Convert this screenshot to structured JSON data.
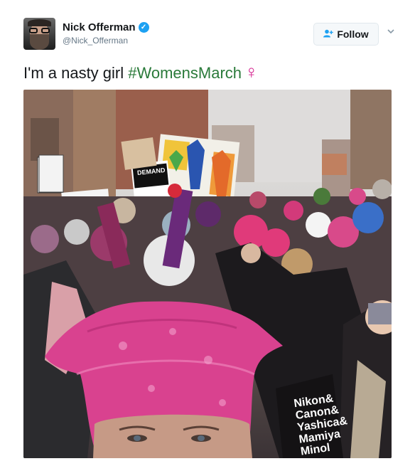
{
  "user": {
    "display_name": "Nick Offerman",
    "handle": "@Nick_Offerman",
    "verified_icon": "verified-badge-icon",
    "avatar_icon": "avatar-photo"
  },
  "follow": {
    "label": "Follow",
    "icon": "add-user-icon",
    "caret_icon": "chevron-down-icon"
  },
  "tweet": {
    "text": "I'm a nasty girl ",
    "hashtag": "#WomensMarch",
    "emoji": "♀"
  },
  "photo": {
    "sign_text": "DEMAND",
    "bag_lines": [
      "Nikon&",
      "Canon&",
      "Yashica&",
      "Mamiya",
      "Minol"
    ]
  },
  "colors": {
    "accent": "#1da1f2",
    "hashtag": "#2a7a3a",
    "emoji": "#d41e8c",
    "hat": "#d9428f"
  }
}
